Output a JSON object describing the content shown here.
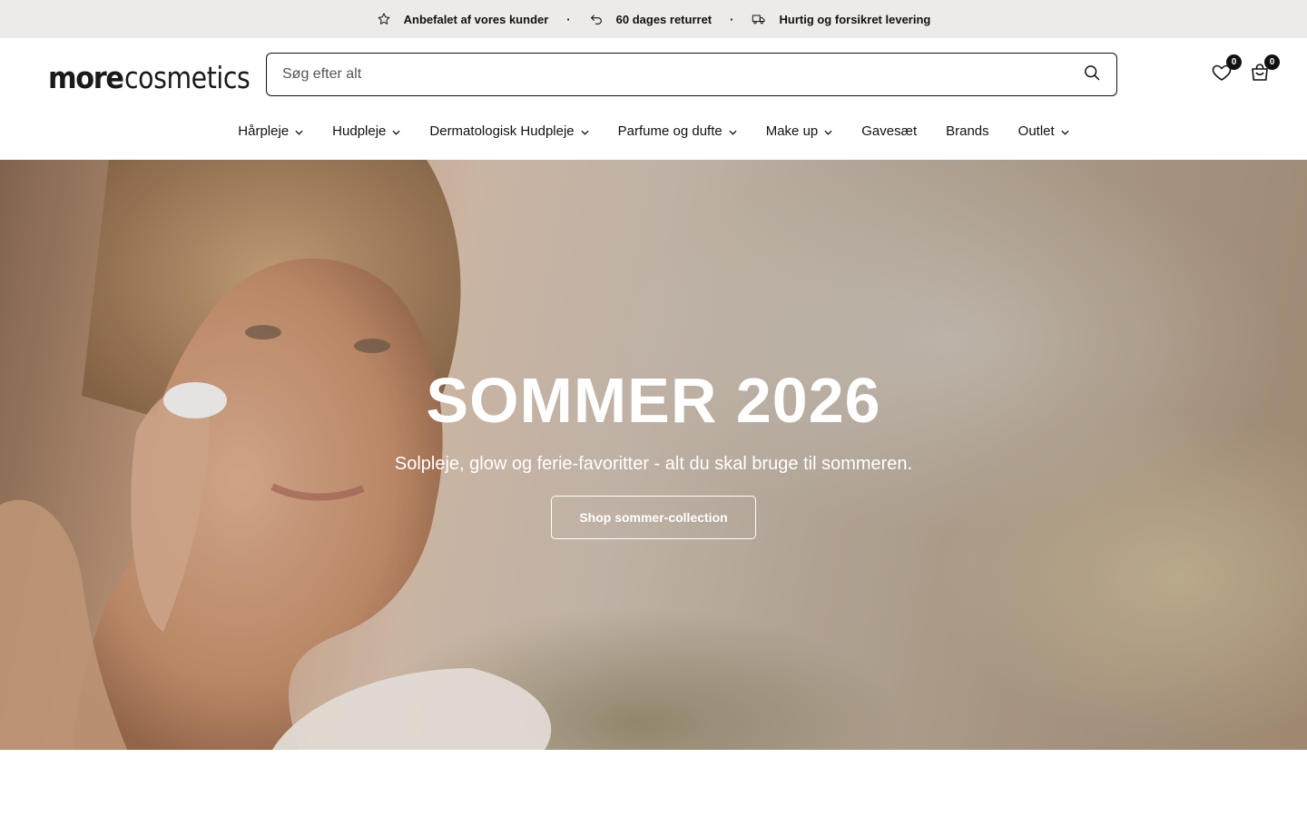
{
  "announcement": {
    "items": [
      {
        "icon": "star-icon",
        "label": "Anbefalet af vores kunder"
      },
      {
        "icon": "return-arrow-icon",
        "label": "60 dages returret"
      },
      {
        "icon": "truck-icon",
        "label": "Hurtig og forsikret levering"
      }
    ],
    "separator": "·"
  },
  "header": {
    "logo": {
      "part1": "more",
      "part2": "cosmetics"
    },
    "search": {
      "placeholder": "Søg efter alt",
      "value": ""
    },
    "wishlist_count": "0",
    "cart_count": "0"
  },
  "nav": {
    "items": [
      {
        "label": "Hårpleje",
        "dropdown": true
      },
      {
        "label": "Hudpleje",
        "dropdown": true
      },
      {
        "label": "Dermatologisk Hudpleje",
        "dropdown": true
      },
      {
        "label": "Parfume og dufte",
        "dropdown": true
      },
      {
        "label": "Make up",
        "dropdown": true
      },
      {
        "label": "Gavesæt",
        "dropdown": false
      },
      {
        "label": "Brands",
        "dropdown": false
      },
      {
        "label": "Outlet",
        "dropdown": true
      }
    ]
  },
  "hero": {
    "title": "SOMMER 2026",
    "subtitle": "Solpleje, glow og ferie-favoritter - alt du skal bruge til sommeren.",
    "cta_label": "Shop sommer-collection"
  },
  "colors": {
    "announcement_bg": "#edebe8",
    "text": "#111111",
    "hero_text": "#ffffff"
  }
}
